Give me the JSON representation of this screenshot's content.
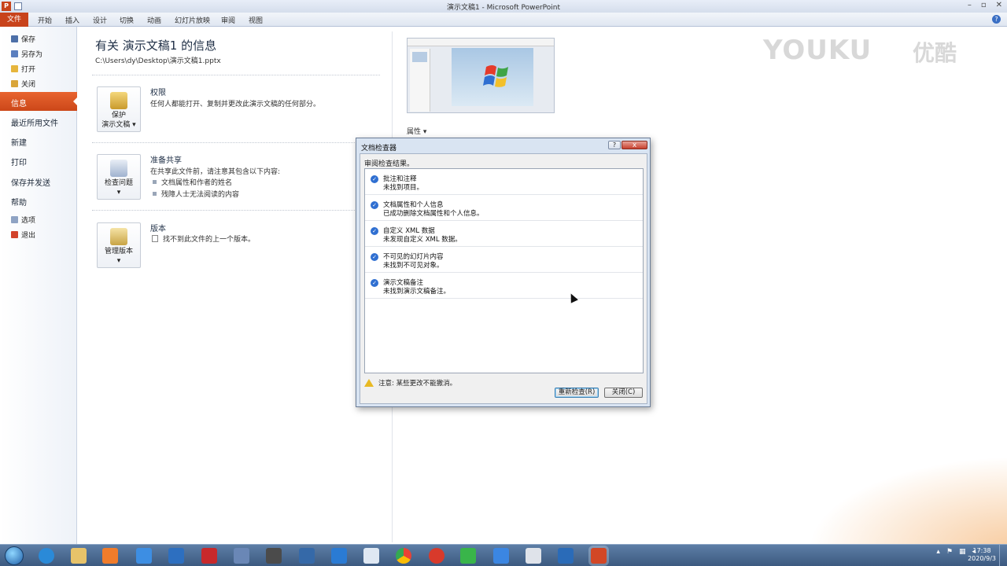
{
  "window": {
    "title": "演示文稿1 - Microsoft PowerPoint",
    "app_icon": "P"
  },
  "ribbon": {
    "tabs": [
      "文件",
      "开始",
      "插入",
      "设计",
      "切换",
      "动画",
      "幻灯片放映",
      "审阅",
      "视图"
    ]
  },
  "backstage": {
    "small_items": [
      "保存",
      "另存为",
      "打开",
      "关闭"
    ],
    "active": "信息",
    "big_items": [
      "最近所用文件",
      "新建",
      "打印",
      "保存并发送",
      "帮助"
    ],
    "bottom_items": [
      "选项",
      "退出"
    ]
  },
  "info": {
    "title": "有关 演示文稿1 的信息",
    "path": "C:\\Users\\dy\\Desktop\\演示文稿1.pptx",
    "permissions": {
      "button_l1": "保护",
      "button_l2": "演示文稿",
      "title": "权限",
      "text": "任何人都能打开、复制并更改此演示文稿的任何部分。"
    },
    "share": {
      "button": "检查问题",
      "title": "准备共享",
      "text": "在共享此文件前，请注意其包含以下内容:",
      "bullets": [
        "文档属性和作者的姓名",
        "残障人士无法阅读的内容"
      ]
    },
    "versions": {
      "button": "管理版本",
      "title": "版本",
      "text": "找不到此文件的上一个版本。"
    },
    "properties_label": "属性"
  },
  "watermark": {
    "text": "YOUKU",
    "cn": "优酷"
  },
  "dialog": {
    "title": "文档检查器",
    "help": "?",
    "close_x": "x",
    "caption": "审阅检查结果。",
    "results": [
      {
        "title": "批注和注释",
        "status": "未找到项目。"
      },
      {
        "title": "文档属性和个人信息",
        "status": "已成功删除文档属性和个人信息。"
      },
      {
        "title": "自定义 XML 数据",
        "status": "未发现自定义 XML 数据。"
      },
      {
        "title": "不可见的幻灯片内容",
        "status": "未找到不可见对象。"
      },
      {
        "title": "演示文稿备注",
        "status": "未找到演示文稿备注。"
      }
    ],
    "note": "注意: 某些更改不能撤消。",
    "recheck": "重新检查(R)",
    "close": "关闭(C)"
  },
  "taskbar": {
    "time": "17:38",
    "date": "2020/9/3"
  }
}
